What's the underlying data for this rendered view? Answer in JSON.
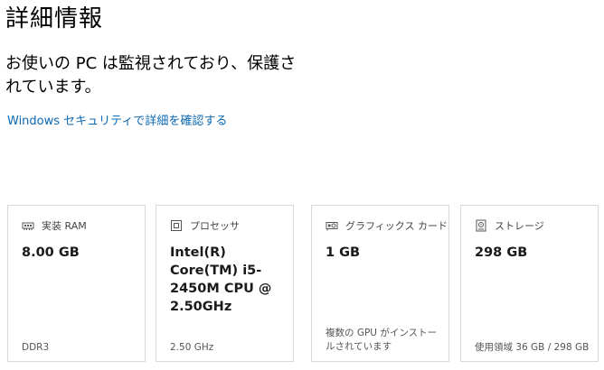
{
  "page": {
    "title": "詳細情報",
    "status_text": "お使いの PC は監視されており、保護されています。",
    "security_link": "Windows セキュリティで詳細を確認する"
  },
  "cards": [
    {
      "icon": "ram-icon",
      "label": "実装 RAM",
      "value": "8.00 GB",
      "note": "",
      "footer": "DDR3"
    },
    {
      "icon": "processor-icon",
      "label": "プロセッサ",
      "value": "Intel(R) Core(TM) i5-2450M CPU @ 2.50GHz",
      "note": "",
      "footer": "2.50 GHz"
    },
    {
      "icon": "graphics-card-icon",
      "label": "グラフィックス カード",
      "value": "1 GB",
      "note": "複数の GPU がインストールされています",
      "footer": ""
    },
    {
      "icon": "storage-icon",
      "label": "ストレージ",
      "value": "298 GB",
      "note": "",
      "footer": "使用領域 36 GB / 298 GB"
    }
  ],
  "colors": {
    "link": "#0b68b3",
    "card_border": "#d8d8d8"
  }
}
